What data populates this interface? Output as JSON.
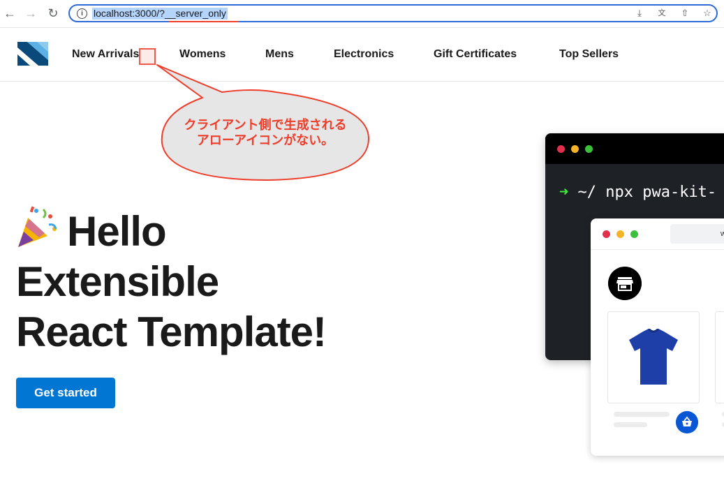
{
  "browser": {
    "url": "localhost:3000/?__server_only",
    "back_icon": "arrow-left-icon",
    "forward_icon": "arrow-right-icon",
    "reload_icon": "reload-icon"
  },
  "header": {
    "logo": "brand-logo",
    "nav": [
      "New Arrivals",
      "Womens",
      "Mens",
      "Electronics",
      "Gift Certificates",
      "Top Sellers"
    ]
  },
  "annotation": {
    "line1": "クライアント側で生成される",
    "line2": "アローアイコンがない。",
    "color": "#ee3d2a"
  },
  "hero": {
    "title_line1": "Hello",
    "title_line2": "Extensible",
    "title_line3": "React Template!",
    "cta_label": "Get started",
    "cta_color": "#0176d3"
  },
  "terminal": {
    "prompt_arrow": "➜",
    "prompt_text": "~/  npx pwa-kit-"
  },
  "mock_browser": {
    "url_fragment": "w"
  }
}
